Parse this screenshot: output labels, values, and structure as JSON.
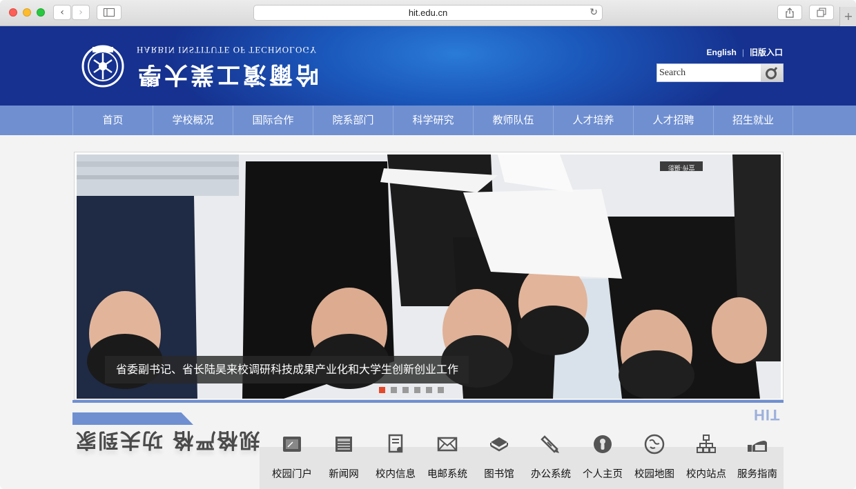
{
  "browser": {
    "url": "hit.edu.cn",
    "back_icon": "chevron-left-icon",
    "forward_icon": "chevron-right-icon"
  },
  "header": {
    "logo_en": "HARBIN INSTITUTE OF TECHNOLOGY",
    "logo_cn": "哈爾濱工業大學",
    "english_link": "English",
    "old_version_link": "旧版入口",
    "search_placeholder": "Search"
  },
  "nav": {
    "items": [
      "首页",
      "学校概况",
      "国际合作",
      "院系部门",
      "科学研究",
      "教师队伍",
      "人才培养",
      "人才招聘",
      "招生就业"
    ]
  },
  "banner": {
    "caption": "省委副书记、省长陆昊来校调研科技成果产业化和大学生创新创业工作",
    "photo_tag": "宣传·摄影",
    "slide_count": 6,
    "active_slide": 1
  },
  "motto": "规格严格 功夫到家",
  "hit_mark": "HIT",
  "services": [
    {
      "label": "校园门户",
      "icon": "portal-icon"
    },
    {
      "label": "新闻网",
      "icon": "news-icon"
    },
    {
      "label": "校内信息",
      "icon": "document-icon"
    },
    {
      "label": "电邮系统",
      "icon": "mail-icon"
    },
    {
      "label": "图书馆",
      "icon": "library-icon"
    },
    {
      "label": "办公系统",
      "icon": "office-icon"
    },
    {
      "label": "个人主页",
      "icon": "person-icon"
    },
    {
      "label": "校园地图",
      "icon": "map-icon"
    },
    {
      "label": "校内站点",
      "icon": "sitemap-icon"
    },
    {
      "label": "服务指南",
      "icon": "service-icon"
    }
  ],
  "colors": {
    "header_dark": "#16318f",
    "header_light": "#2a7bd8",
    "nav": "#6f8fd1",
    "active_dot": "#e5482a"
  }
}
